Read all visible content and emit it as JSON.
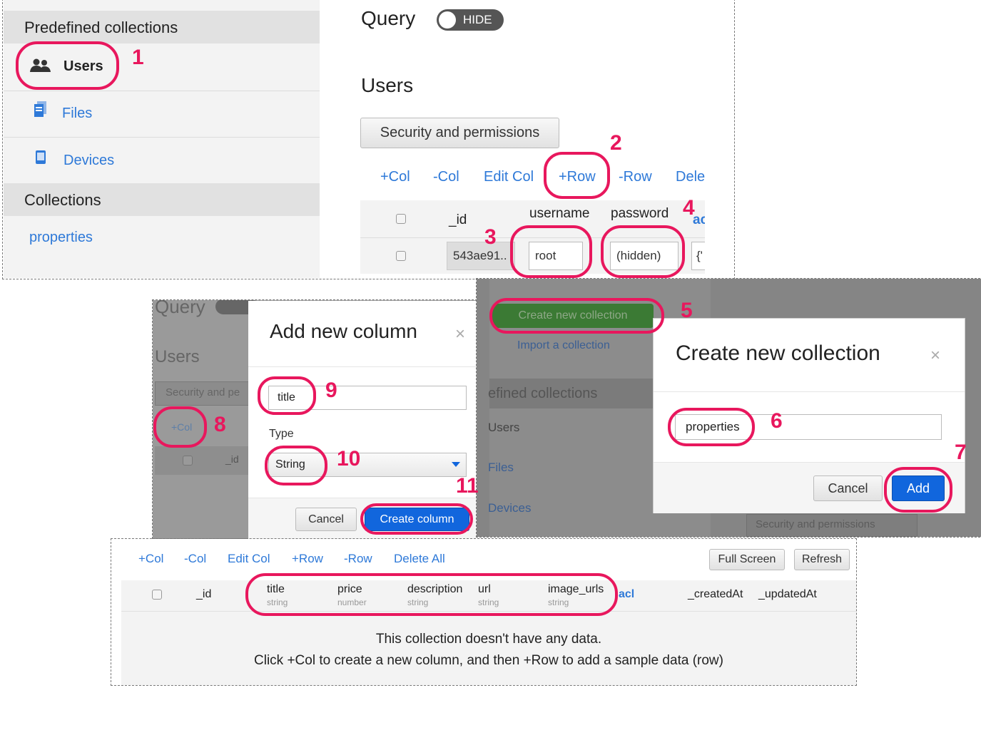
{
  "sidebar": {
    "predefined_header": "Predefined collections",
    "items": [
      {
        "label": "Users",
        "icon": "users-icon"
      },
      {
        "label": "Files",
        "icon": "file-icon"
      },
      {
        "label": "Devices",
        "icon": "device-icon"
      }
    ],
    "collections_header": "Collections",
    "collections": [
      {
        "label": "properties"
      }
    ]
  },
  "query": {
    "label": "Query",
    "toggle_label": "HIDE"
  },
  "users_panel": {
    "title": "Users",
    "security_button": "Security and permissions",
    "toolbar": [
      "+Col",
      "-Col",
      "Edit Col",
      "+Row",
      "-Row",
      "Dele"
    ],
    "columns": [
      "_id",
      "username",
      "password",
      "ac"
    ],
    "row": {
      "id": "543ae91..",
      "username": "root",
      "password": "(hidden)",
      "acl": "{'"
    }
  },
  "add_column_dialog": {
    "bg_query": "Query",
    "bg_users": "Users",
    "bg_security": "Security and pe",
    "bg_col": "+Col",
    "bg_id": "_id",
    "title": "Add new column",
    "close": "×",
    "name_value": "title",
    "type_label": "Type",
    "type_value": "String",
    "cancel": "Cancel",
    "create": "Create column"
  },
  "create_collection_dialog": {
    "create_btn": "Create new collection",
    "import_link": "Import a collection",
    "bg_predefined": "efined collections",
    "bg_items": [
      "Users",
      "Files",
      "Devices"
    ],
    "bg_security": "Security and permissions",
    "title": "Create new collection",
    "close": "×",
    "name_value": "properties",
    "cancel": "Cancel",
    "add": "Add"
  },
  "bottom_panel": {
    "toolbar": [
      "+Col",
      "-Col",
      "Edit Col",
      "+Row",
      "-Row",
      "Delete All"
    ],
    "full_screen": "Full Screen",
    "refresh": "Refresh",
    "columns": [
      {
        "name": "_id",
        "type": ""
      },
      {
        "name": "title",
        "type": "string"
      },
      {
        "name": "price",
        "type": "number"
      },
      {
        "name": "description",
        "type": "string"
      },
      {
        "name": "url",
        "type": "string"
      },
      {
        "name": "image_urls",
        "type": "string"
      },
      {
        "name": "acl",
        "type": ""
      },
      {
        "name": "_createdAt",
        "type": ""
      },
      {
        "name": "_updatedAt",
        "type": ""
      }
    ],
    "empty_line1": "This collection doesn't have any data.",
    "empty_line2": "Click +Col to create a new column, and then +Row to add a sample data (row)"
  },
  "annotations": [
    "1",
    "2",
    "3",
    "4",
    "5",
    "6",
    "7",
    "8",
    "9",
    "10",
    "11"
  ],
  "colors": {
    "accent": "#e8175d",
    "link": "#2e79d8",
    "primary": "#1166dd",
    "green": "#4fa043"
  }
}
